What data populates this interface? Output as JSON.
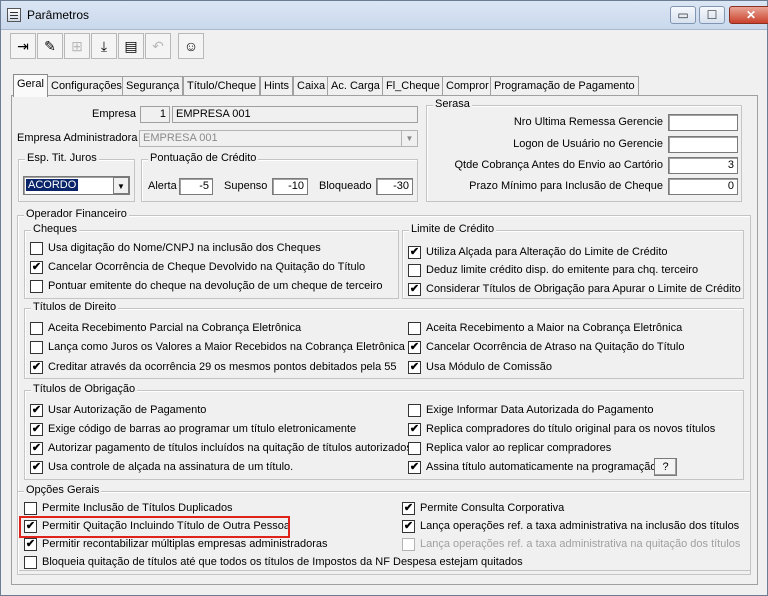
{
  "window": {
    "title": "Parâmetros"
  },
  "titlebar": {
    "minimize": "▭",
    "maximize": "☐",
    "close": "✕"
  },
  "toolbar": {
    "icons": [
      "exit-door-icon",
      "eraser-icon",
      "tree-icon",
      "save-download-icon",
      "print-icon",
      "undo-icon",
      "user-icon"
    ]
  },
  "tabs": [
    "Geral",
    "Configurações",
    "Segurança",
    "Título/Cheque",
    "Hints",
    "Caixa",
    "Ac. Carga",
    "Fl_Cheque",
    "Compror",
    "Programação de Pagamento"
  ],
  "empresa": {
    "label": "Empresa",
    "code": "1",
    "name": "EMPRESA 001"
  },
  "empresa_adm": {
    "label": "Empresa Administradora",
    "value": "EMPRESA 001"
  },
  "esp_tit": {
    "title": "Esp. Tit. Juros",
    "value": "ACORDO"
  },
  "pontuacao": {
    "title": "Pontuação de Crédito",
    "alerta_label": "Alerta",
    "alerta": "-5",
    "supenso_label": "Supenso",
    "supenso": "-10",
    "bloqueado_label": "Bloqueado",
    "bloqueado": "-30"
  },
  "serasa": {
    "title": "Serasa",
    "rows": [
      {
        "label": "Nro Ultima Remessa Gerencie",
        "value": ""
      },
      {
        "label": "Logon de Usuário no Gerencie",
        "value": ""
      },
      {
        "label": "Qtde Cobrança  Antes do Envio ao Cartório",
        "value": "3"
      },
      {
        "label": "Prazo Mínimo para Inclusão de Cheque",
        "value": "0"
      }
    ]
  },
  "operador": {
    "title": "Operador Financeiro"
  },
  "cheques": {
    "title": "Cheques",
    "items": [
      {
        "label": "Usa digitação do Nome/CNPJ na inclusão dos Cheques",
        "checked": false
      },
      {
        "label": "Cancelar Ocorrência de Cheque Devolvido na Quitação do Título",
        "checked": true
      },
      {
        "label": "Pontuar emitente do cheque na devolução de um cheque de terceiro",
        "checked": false
      }
    ]
  },
  "limite": {
    "title": "Limite de Crédito",
    "items": [
      {
        "label": "Utiliza Alçada para Alteração do Limite de Crédito",
        "checked": true
      },
      {
        "label": "Deduz limite crédito disp. do emitente para chq. terceiro",
        "checked": false
      },
      {
        "label": "Considerar Títulos de Obrigação para Apurar o Limite de Crédito",
        "checked": true
      }
    ]
  },
  "direito": {
    "title": "Títulos de Direito",
    "left": [
      {
        "label": "Aceita Recebimento Parcial na Cobrança Eletrônica",
        "checked": false
      },
      {
        "label": "Lança como Juros os Valores a Maior Recebidos na Cobrança Eletrônica",
        "checked": false
      },
      {
        "label": "Creditar através da ocorrência 29 os mesmos pontos debitados pela 55",
        "checked": true
      }
    ],
    "right": [
      {
        "label": "Aceita Recebimento a Maior na Cobrança Eletrônica",
        "checked": false
      },
      {
        "label": "Cancelar Ocorrência de Atraso na Quitação do Título",
        "checked": true
      },
      {
        "label": "Usa Módulo de Comissão",
        "checked": true
      }
    ]
  },
  "obrigacao": {
    "title": "Títulos de Obrigação",
    "left": [
      {
        "label": "Usar Autorização de Pagamento",
        "checked": true
      },
      {
        "label": "Exige código de barras ao programar um título eletronicamente",
        "checked": true
      },
      {
        "label": "Autorizar pagamento de títulos incluídos na quitação de títulos autorizados",
        "checked": true
      },
      {
        "label": "Usa controle de alçada na assinatura de um título.",
        "checked": true
      }
    ],
    "right": [
      {
        "label": "Exige Informar Data Autorizada do Pagamento",
        "checked": false
      },
      {
        "label": "Replica compradores do título original para os novos títulos",
        "checked": true
      },
      {
        "label": "Replica valor ao replicar compradores",
        "checked": false
      },
      {
        "label": "Assina título automaticamente na programação.",
        "checked": true
      }
    ],
    "help_label": "?"
  },
  "opcoes": {
    "title": "Opções Gerais",
    "left": [
      {
        "label": "Permite Inclusão de Títulos Duplicados",
        "checked": false
      },
      {
        "label": "Permitir Quitação Incluindo Título de Outra Pessoa",
        "checked": true
      },
      {
        "label": "Permitir recontabilizar múltiplas empresas administradoras",
        "checked": true
      }
    ],
    "right": [
      {
        "label": "Permite Consulta Corporativa",
        "checked": true
      },
      {
        "label": "Lança operações ref. a taxa administrativa na inclusão dos títulos",
        "checked": true
      },
      {
        "label": "Lança operações ref. a taxa administrativa na quitação dos títulos",
        "checked": false,
        "disabled": true
      }
    ],
    "bottom": {
      "label": "Bloqueia quitação de títulos até que todos os títulos de Impostos da NF Despesa estejam quitados",
      "checked": false
    }
  },
  "colors": {
    "highlight": "#e0231a",
    "selection": "#0a246a"
  }
}
